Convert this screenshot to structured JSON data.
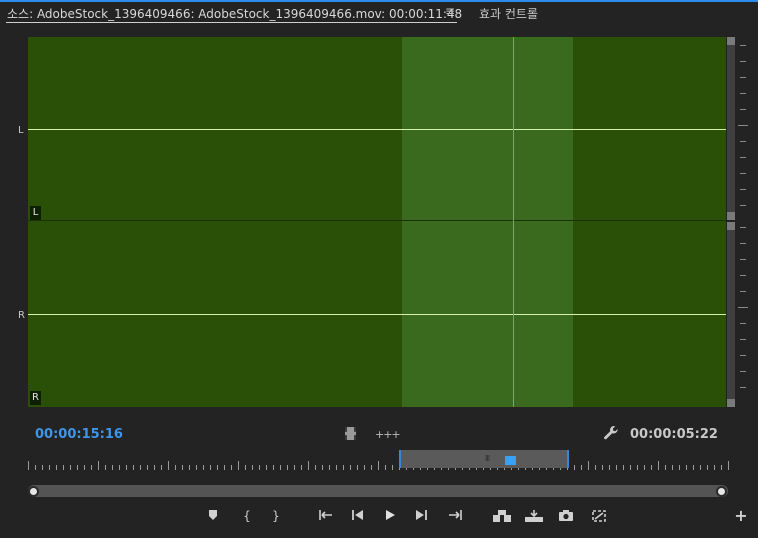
{
  "tabs": {
    "source_label": "소스: AdobeStock_1396409466: AdobeStock_1396409466.mov: 00:00:11:48",
    "menu_icon": "≡",
    "effects_label": "효과 컨트롤"
  },
  "waveform": {
    "upper_side_label": "L",
    "lower_side_label": "R",
    "upper_tag": "L",
    "lower_tag": "R",
    "colors": {
      "background": "#295006",
      "selection": "#3a6a1e",
      "playhead": "#2fb6e6"
    }
  },
  "timecode": {
    "playhead": "00:00:15:16",
    "duration": "00:00:05:22"
  },
  "icons": {
    "drag_video": "film-icon",
    "drag_audio": "audio-waveform-icon",
    "settings": "wrench-icon",
    "audio_glyph": "+++"
  },
  "controls": [
    {
      "name": "add-marker-button",
      "icon": "marker-icon"
    },
    {
      "name": "mark-in-button",
      "icon": "mark-in-icon",
      "glyph": "{"
    },
    {
      "name": "mark-out-button",
      "icon": "mark-out-icon",
      "glyph": "}"
    },
    {
      "name": "go-to-in-button",
      "icon": "go-to-in-icon"
    },
    {
      "name": "step-back-button",
      "icon": "step-back-icon"
    },
    {
      "name": "play-button",
      "icon": "play-icon"
    },
    {
      "name": "step-forward-button",
      "icon": "step-forward-icon"
    },
    {
      "name": "go-to-out-button",
      "icon": "go-to-out-icon"
    },
    {
      "name": "insert-button",
      "icon": "insert-icon"
    },
    {
      "name": "overwrite-button",
      "icon": "overwrite-icon"
    },
    {
      "name": "export-frame-button",
      "icon": "camera-icon"
    },
    {
      "name": "proxy-toggle-button",
      "icon": "proxy-icon"
    },
    {
      "name": "button-editor-button",
      "icon": "plus-icon",
      "glyph": "+"
    }
  ]
}
